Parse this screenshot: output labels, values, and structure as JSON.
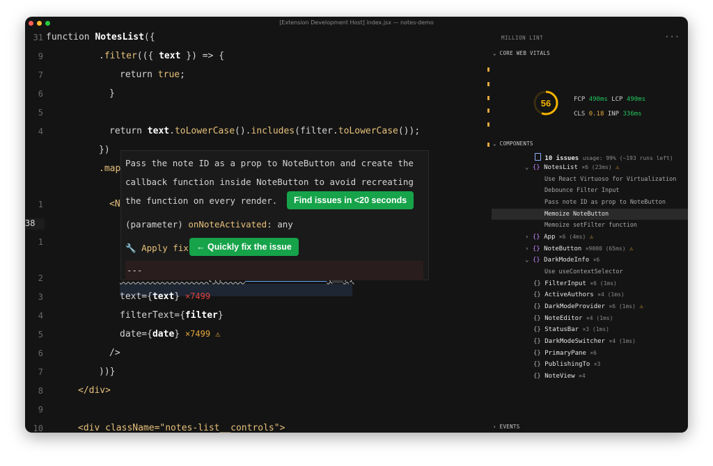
{
  "window": {
    "title": "[Extension Development Host] index.jsx — notes-demo"
  },
  "editor": {
    "line_numbers": [
      "31",
      "9",
      "7",
      "6",
      "5",
      "4",
      "",
      "",
      "",
      "1",
      "38",
      "1",
      "",
      "2",
      "3",
      "4",
      "5",
      "6",
      "7",
      "8",
      "9",
      "10"
    ],
    "lines": {
      "l31_kw": "function ",
      "l31_fn": "NotesList",
      "l31_rest": "({",
      "l9_a": ".",
      "l9_fn": "filter",
      "l9_b": "(({ ",
      "l9_c": "text",
      "l9_d": " }) => {",
      "l7_kw": "return ",
      "l7_b": "true",
      "l7_c": ";",
      "l6": "}",
      "l4_kw": "return ",
      "l4_b": "text",
      "l4_c": ".",
      "l4_fn1": "toLowerCase",
      "l4_d": "().",
      "l4_fn2": "includes",
      "l4_e": "(filter.",
      "l4_fn3": "toLowerCase",
      "l4_f": "());",
      "lclose": "})",
      "lmap": ".map",
      "lN": "<N",
      "l2_a": "onNoteActivated={",
      "l2_b": "() => ",
      "l2_c": "onNoteActivated",
      "l2_d": "(",
      "l2_e": "id",
      "l2_f": ")}",
      "l2_badge": "×7499 ⚠",
      "l3_a": "text={",
      "l3_b": "text",
      "l3_c": "}",
      "l3_badge": "×7499",
      "l4b_a": "filterText={",
      "l4b_b": "filter",
      "l4b_c": "}",
      "l5_a": "date={",
      "l5_b": "date",
      "l5_c": "}",
      "l5_badge": "×7499 ⚠",
      "l6b": "/>",
      "l7b": "))}",
      "l8": "</div>",
      "l10": "<div className=\"notes-list__controls\">"
    }
  },
  "hover": {
    "msg1": "Pass the note ID as a prop to NoteButton and create the",
    "msg2": "callback function inside NoteButton to avoid recreating",
    "msg3": "the function on every render.",
    "find_btn": "Find issues in <20 seconds",
    "param_a": "(parameter) ",
    "param_b": "onNoteActivated",
    "param_c": ": any",
    "apply_fix": "🔧 Apply fix",
    "quick_btn": "← Quickly fix the issue",
    "sep": "---"
  },
  "panel": {
    "title": "MILLION LINT",
    "more": "···",
    "cwv": "CORE WEB VITALS",
    "score": "56",
    "score_fraction": 0.56,
    "fcp_label": "FCP",
    "fcp": "490ms",
    "lcp_label": "LCP",
    "lcp": "490ms",
    "cls_label": "CLS",
    "cls": "0.18",
    "inp_label": "INP",
    "inp": "336ms",
    "components": "COMPONENTS",
    "issues_count": "10 issues",
    "issues_meta": "usage: 99% (~193 runs left)",
    "events": "EVENTS",
    "tree": [
      {
        "name": "NotesList",
        "meta": "×6 (23ms)"
      },
      {
        "name": "Use React Virtuoso for Virtualization"
      },
      {
        "name": "Debounce Filter Input"
      },
      {
        "name": "Pass note ID as prop to NoteButton"
      },
      {
        "name": "Memoize NoteButton"
      },
      {
        "name": "Memoize setFilter function"
      },
      {
        "name": "App",
        "meta": "×6 (4ms)"
      },
      {
        "name": "NoteButton",
        "meta": "×9000 (65ms)"
      },
      {
        "name": "DarkModeInfo",
        "meta": "×6"
      },
      {
        "name": "Use useContextSelector"
      },
      {
        "name": "FilterInput",
        "meta": "×6 (1ms)"
      },
      {
        "name": "ActiveAuthors",
        "meta": "×4 (1ms)"
      },
      {
        "name": "DarkModeProvider",
        "meta": "×6 (1ms)"
      },
      {
        "name": "NoteEditor",
        "meta": "×4 (1ms)"
      },
      {
        "name": "StatusBar",
        "meta": "×3 (1ms)"
      },
      {
        "name": "DarkModeSwitcher",
        "meta": "×4 (1ms)"
      },
      {
        "name": "PrimaryPane",
        "meta": "×6"
      },
      {
        "name": "PublishingTo",
        "meta": "×3"
      },
      {
        "name": "NoteView",
        "meta": "×4"
      }
    ]
  },
  "colors": {
    "accent_green": "#16a34a",
    "warn": "#e5a83b",
    "score_ring": "#f5b400"
  }
}
